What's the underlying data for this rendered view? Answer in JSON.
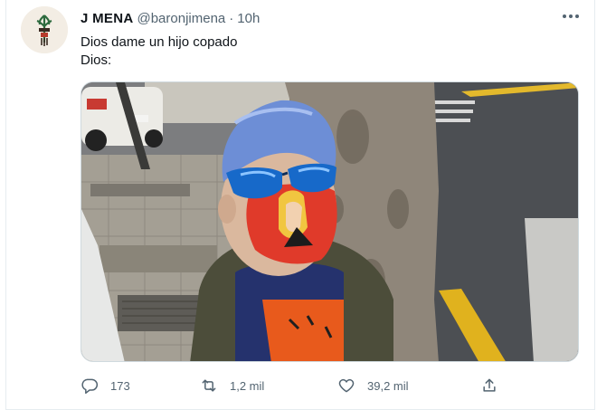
{
  "tweet": {
    "display_name": "J MENA",
    "handle": "@baronjimena",
    "separator": "·",
    "time": "10h",
    "text_lines": [
      "Dios dame un hijo copado",
      "Dios:"
    ],
    "stats": {
      "replies": "173",
      "retweets": "1,2 mil",
      "likes": "39,2 mil"
    }
  },
  "icons": {
    "more": "more-dots-icon",
    "reply": "reply-icon",
    "retweet": "retweet-icon",
    "like": "heart-icon",
    "share": "share-icon"
  },
  "colors": {
    "text": "#0f1419",
    "muted": "#536471",
    "border": "#cfd9de"
  }
}
